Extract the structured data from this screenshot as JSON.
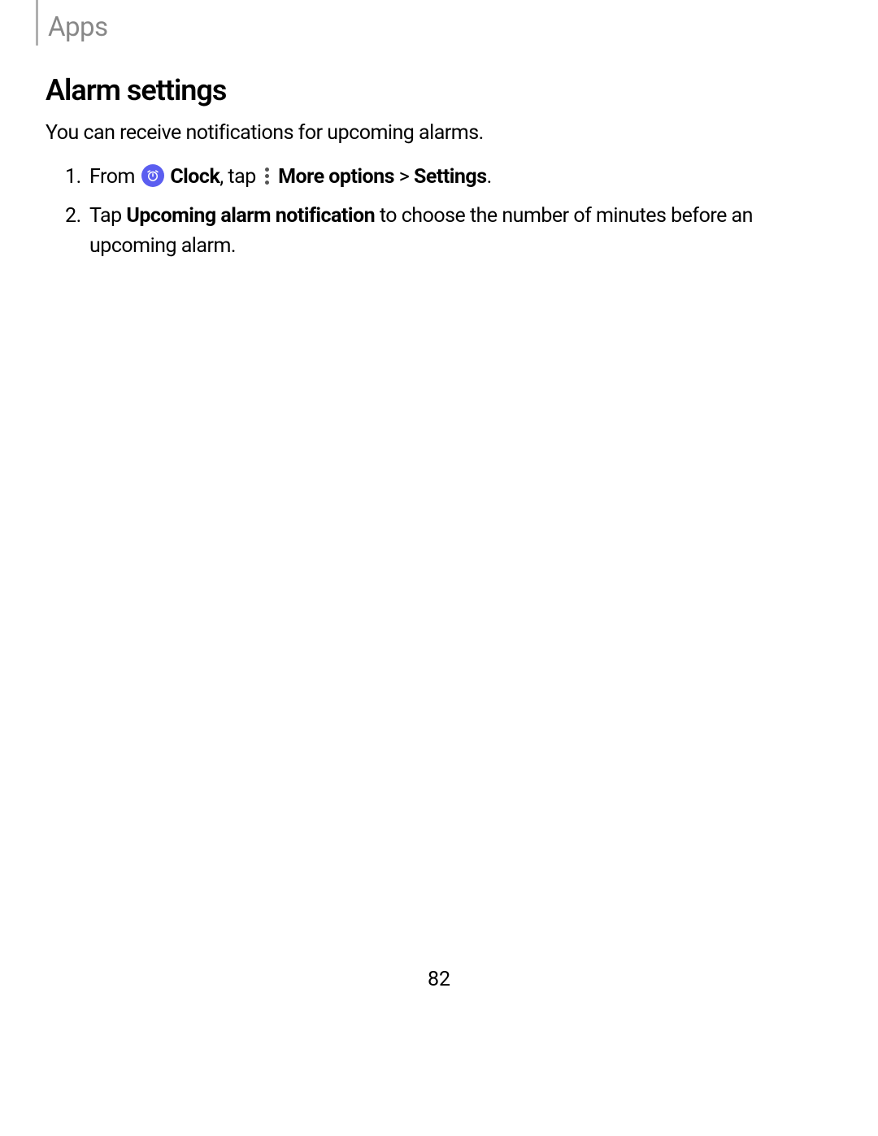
{
  "header": {
    "breadcrumb": "Apps"
  },
  "content": {
    "title": "Alarm settings",
    "intro": "You can receive notifications for upcoming alarms.",
    "step1": {
      "pre_icon": "From ",
      "clock_label": "Clock",
      "after_clock": ", tap ",
      "more_options_label": "More options",
      "separator": " > ",
      "settings_label": "Settings",
      "end": "."
    },
    "step2": {
      "pre_bold": "Tap ",
      "bold_label": "Upcoming alarm notification",
      "post_bold": " to choose the number of minutes before an upcoming alarm."
    }
  },
  "footer": {
    "page_number": "82"
  }
}
